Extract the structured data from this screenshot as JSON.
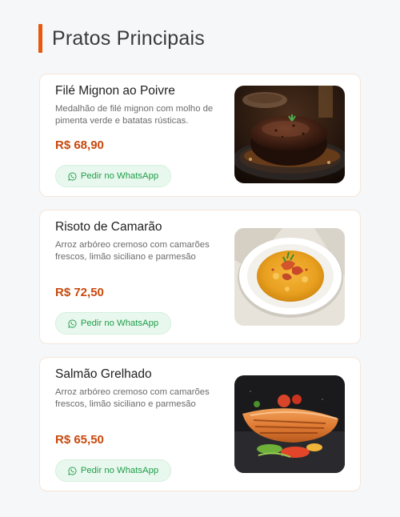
{
  "section": {
    "title": "Pratos Principais"
  },
  "dishes": [
    {
      "name": "Filé Mignon ao Poivre",
      "description": "Medalhão de filé mignon com molho de pimenta verde e batatas rústicas.",
      "price": "R$ 68,90",
      "button_label": "Pedir no WhatsApp",
      "image": "steak-photo"
    },
    {
      "name": "Risoto de Camarão",
      "description": "Arroz arbóreo cremoso com camarões frescos, limão siciliano e parmesão",
      "price": "R$ 72,50",
      "button_label": "Pedir no WhatsApp",
      "image": "risotto-photo"
    },
    {
      "name": "Salmão Grelhado",
      "description": "Arroz arbóreo cremoso com camarões frescos, limão siciliano e parmesão",
      "price": "R$ 65,50",
      "button_label": "Pedir no WhatsApp",
      "image": "salmon-photo"
    }
  ],
  "colors": {
    "accent": "#e8590c",
    "price": "#c8490d",
    "whatsapp_green": "#1f9d4a",
    "whatsapp_bg": "#e9f8ee"
  }
}
